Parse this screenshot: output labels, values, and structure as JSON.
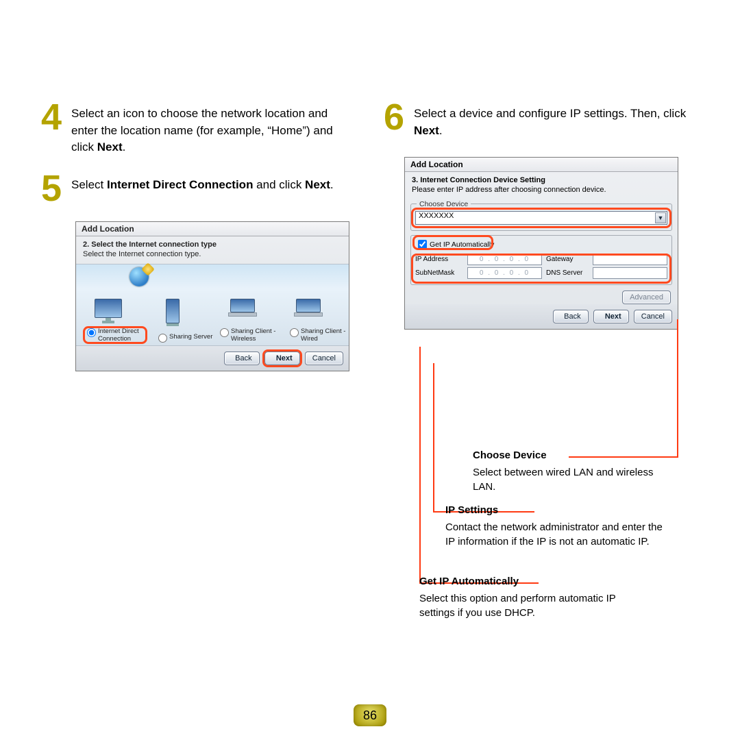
{
  "steps": {
    "s4": {
      "num": "4",
      "text_a": "Select an icon to choose the network location and enter the location name (for example, “Home”) and click ",
      "bold_a": "Next",
      "text_b": "."
    },
    "s5": {
      "num": "5",
      "text_a": "Select ",
      "bold_a": "Internet Direct Connection",
      "text_b": " and click ",
      "bold_b": "Next",
      "text_c": "."
    },
    "s6": {
      "num": "6",
      "text_a": "Select a device and configure IP settings. Then, click ",
      "bold_a": "Next",
      "text_b": "."
    }
  },
  "dlg5": {
    "title": "Add Location",
    "sub": "2. Select the Internet connection type",
    "text": "Select the Internet connection type.",
    "opts": [
      "Internet Direct Connection",
      "Sharing Server",
      "Sharing Client - Wireless",
      "Sharing Client - Wired"
    ],
    "btns": {
      "back": "Back",
      "next": "Next",
      "cancel": "Cancel"
    }
  },
  "dlg6": {
    "title": "Add Location",
    "sub": "3. Internet Connection Device Setting",
    "text": "Please enter IP address after choosing connection device.",
    "choose_label": "Choose Device",
    "device_value": "XXXXXXX",
    "get_ip": "Get IP Automatically",
    "labels": {
      "ip": "IP Address",
      "mask": "SubNetMask",
      "gw": "Gateway",
      "dns": "DNS Server"
    },
    "ip_placeholder": "0 . 0 . 0 . 0",
    "btns": {
      "adv": "Advanced",
      "back": "Back",
      "next": "Next",
      "cancel": "Cancel"
    }
  },
  "annos": {
    "choose": {
      "title": "Choose Device",
      "body": "Select between wired LAN and wireless LAN."
    },
    "ip": {
      "title": "IP Settings",
      "body": "Contact the network administrator and enter the IP information if the IP is not an automatic IP."
    },
    "auto": {
      "title": "Get IP Automatically",
      "body": "Select this option and perform automatic IP settings if you use DHCP."
    }
  },
  "page_number": "86"
}
